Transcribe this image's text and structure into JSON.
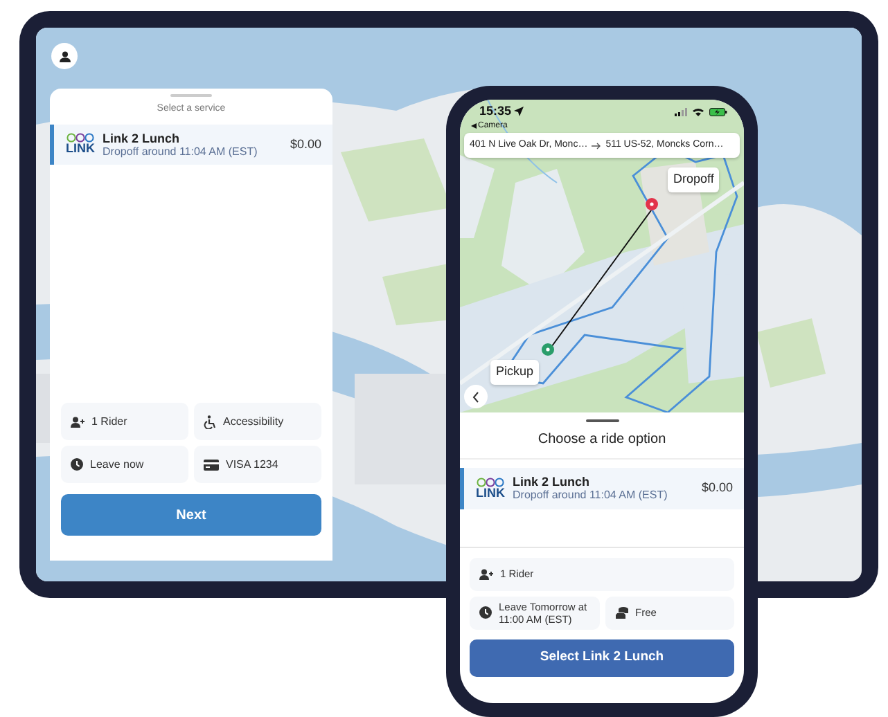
{
  "tablet": {
    "service_panel": {
      "title": "Select a service",
      "services": [
        {
          "name": "Link 2 Lunch",
          "detail": "Dropoff around 11:04 AM (EST)",
          "price": "$0.00",
          "logo_text": "LINK",
          "selected": true
        }
      ],
      "options": [
        {
          "kind": "rider",
          "label": "1 Rider"
        },
        {
          "kind": "accessibility",
          "label": "Accessibility"
        },
        {
          "kind": "time",
          "label": "Leave now"
        },
        {
          "kind": "payment",
          "label": "VISA 1234"
        }
      ],
      "button": "Next"
    }
  },
  "phone": {
    "status_bar": {
      "time": "15:35",
      "back_label": "Camera"
    },
    "route": {
      "from": "401 N Live Oak Dr, Monc…",
      "to": "511 US-52, Moncks Corn…"
    },
    "map": {
      "dropoff_label": "Dropoff",
      "pickup_label": "Pickup"
    },
    "sheet": {
      "title": "Choose a ride option",
      "services": [
        {
          "name": "Link 2 Lunch",
          "detail": "Dropoff around 11:04 AM (EST)",
          "price": "$0.00",
          "logo_text": "LINK",
          "selected": true
        }
      ],
      "options": [
        {
          "kind": "rider",
          "label": "1 Rider"
        },
        {
          "kind": "time",
          "label": "Leave Tomorrow at 11:00 AM (EST)"
        },
        {
          "kind": "fare",
          "label": "Free"
        }
      ],
      "button": "Select Link 2 Lunch"
    }
  }
}
